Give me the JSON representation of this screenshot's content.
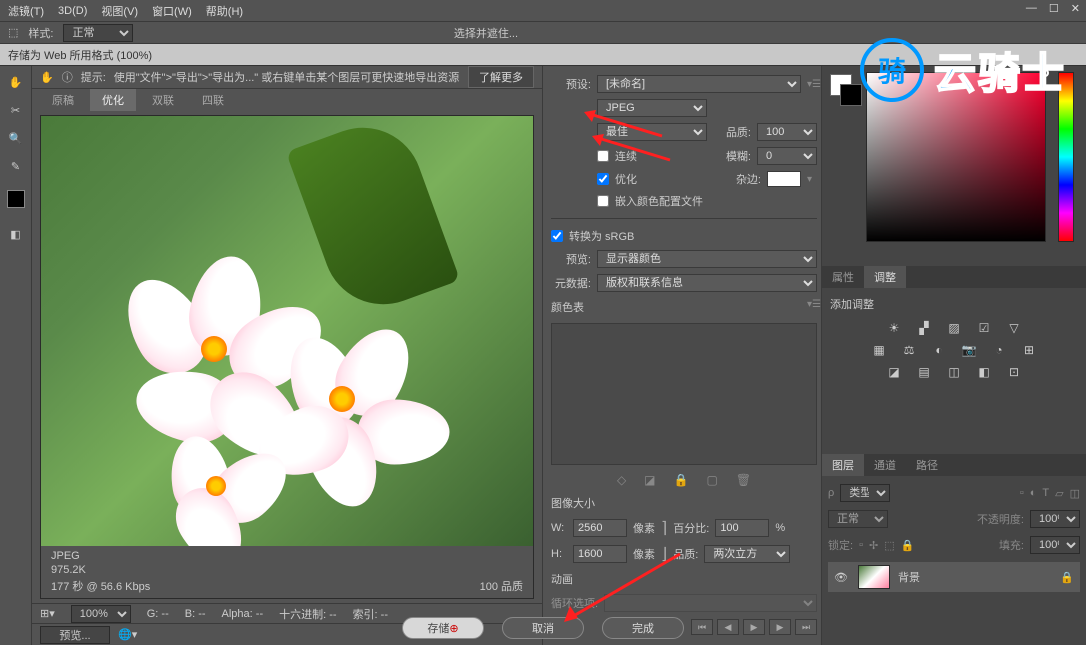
{
  "menu": {
    "items": [
      "滤镜(T)",
      "3D(D)",
      "视图(V)",
      "窗口(W)",
      "帮助(H)"
    ]
  },
  "optbar": {
    "style_label": "样式:",
    "style_value": "正常",
    "select_and": "选择并遮住..."
  },
  "doc_tab": "存储为 Web 所用格式 (100%)",
  "hint": {
    "prefix": "提示:",
    "text": "使用\"文件\">\"导出\">\"导出为...\" 或右键单击某个图层可更快速地导出资源",
    "learn_more": "了解更多"
  },
  "view_tabs": [
    "原稿",
    "优化",
    "双联",
    "四联"
  ],
  "view_tab_active": 1,
  "preview_meta": {
    "format": "JPEG",
    "size": "975.2K",
    "time": "177 秒 @ 56.6 Kbps",
    "quality": "100 品质"
  },
  "status": {
    "zoom": "100%",
    "g": "G: --",
    "b": "B: --",
    "alpha": "Alpha: --",
    "hex": "十六进制: --",
    "index": "索引: --"
  },
  "preview_btn": "预览...",
  "settings": {
    "preset_label": "预设:",
    "preset_value": "[未命名]",
    "format": "JPEG",
    "quality_preset": "最佳",
    "quality_label": "品质:",
    "quality_value": "100",
    "progressive": "连续",
    "blur_label": "模糊:",
    "blur_value": "0",
    "optimized": "优化",
    "matte_label": "杂边:",
    "embed_profile": "嵌入颜色配置文件",
    "convert_srgb": "转换为 sRGB",
    "preview_label": "预览:",
    "preview_value": "显示器颜色",
    "metadata_label": "元数据:",
    "metadata_value": "版权和联系信息",
    "color_table": "颜色表",
    "image_size": "图像大小",
    "w_label": "W:",
    "w_value": "2560",
    "px": "像素",
    "h_label": "H:",
    "h_value": "1600",
    "percent_label": "百分比:",
    "percent_value": "100",
    "percent_unit": "%",
    "resample_label": "品质:",
    "resample_value": "两次立方",
    "animation": "动画",
    "loop_label": "循环选项:"
  },
  "panels": {
    "properties": "属性",
    "adjustments": "调整",
    "add_adjustment": "添加调整",
    "layers": "图层",
    "channels": "通道",
    "paths": "路径",
    "layer_kind": "类型",
    "blend_mode": "正常",
    "opacity_label": "不透明度:",
    "opacity": "100%",
    "lock_label": "锁定:",
    "fill_label": "填充:",
    "fill": "100%",
    "bg_layer": "背景"
  },
  "buttons": {
    "save": "存储",
    "cancel": "取消",
    "done": "完成"
  },
  "watermark": "云骑士"
}
